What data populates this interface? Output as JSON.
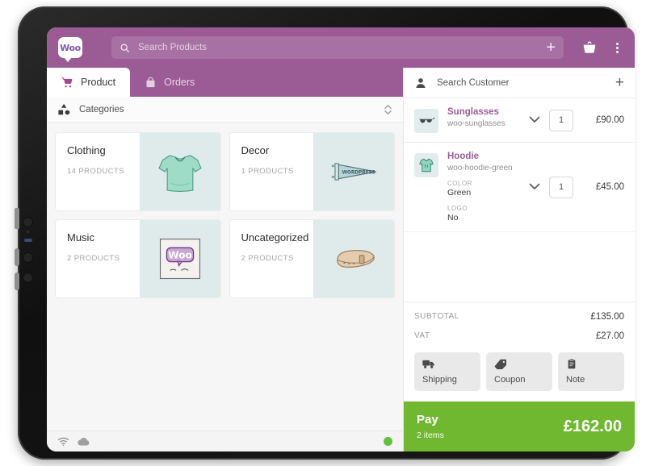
{
  "app": {
    "logo_text": "Woo",
    "brand_purple": "#9b5c96",
    "brand_green": "#6fb830",
    "accent_magenta": "#9b5c96"
  },
  "topbar": {
    "search_placeholder": "Search Products",
    "search_value": "",
    "add_label": "+",
    "basket_icon": "shopping-basket-icon",
    "overflow_icon": "more-vertical-icon",
    "search_icon": "search-icon"
  },
  "tabs": [
    {
      "label": "Product",
      "icon": "shopping-cart-icon",
      "active": true
    },
    {
      "label": "Orders",
      "icon": "bag-icon",
      "active": false
    }
  ],
  "categories_header": {
    "title": "Categories",
    "icon": "shapes-icon",
    "sort_icon": "sort-updown-icon"
  },
  "categories": [
    {
      "name": "Clothing",
      "count": "14 PRODUCTS",
      "thumb": "tshirt-image"
    },
    {
      "name": "Decor",
      "count": "1 PRODUCTS",
      "thumb": "pennant-image"
    },
    {
      "name": "Music",
      "count": "2 PRODUCTS",
      "thumb": "woo-album-image"
    },
    {
      "name": "Uncategorized",
      "count": "2 PRODUCTS",
      "thumb": "belt-image"
    }
  ],
  "statusbar": {
    "wifi_icon": "wifi-icon",
    "cloud_icon": "cloud-icon",
    "online_indicator": "online-status-dot"
  },
  "customer": {
    "placeholder": "Search Customer",
    "value": "",
    "person_icon": "person-icon",
    "add_label": "+"
  },
  "cart_items": [
    {
      "title": "Sunglasses",
      "sku": "woo-sunglasses",
      "thumb": "sunglasses-image",
      "qty": "1",
      "price": "£90.00",
      "attributes": []
    },
    {
      "title": "Hoodie",
      "sku": "woo-hoodie-green",
      "thumb": "hoodie-image",
      "qty": "1",
      "price": "£45.00",
      "attributes": [
        {
          "label": "COLOR",
          "value": "Green"
        },
        {
          "label": "LOGO",
          "value": "No"
        }
      ]
    }
  ],
  "totals": [
    {
      "label": "SUBTOTAL",
      "value": "£135.00"
    },
    {
      "label": "VAT",
      "value": "£27.00"
    }
  ],
  "action_buttons": [
    {
      "label": "Shipping",
      "icon": "truck-icon"
    },
    {
      "label": "Coupon",
      "icon": "tag-icon"
    },
    {
      "label": "Note",
      "icon": "clipboard-icon"
    }
  ],
  "pay": {
    "label": "Pay",
    "items": "2 items",
    "amount": "£162.00"
  }
}
